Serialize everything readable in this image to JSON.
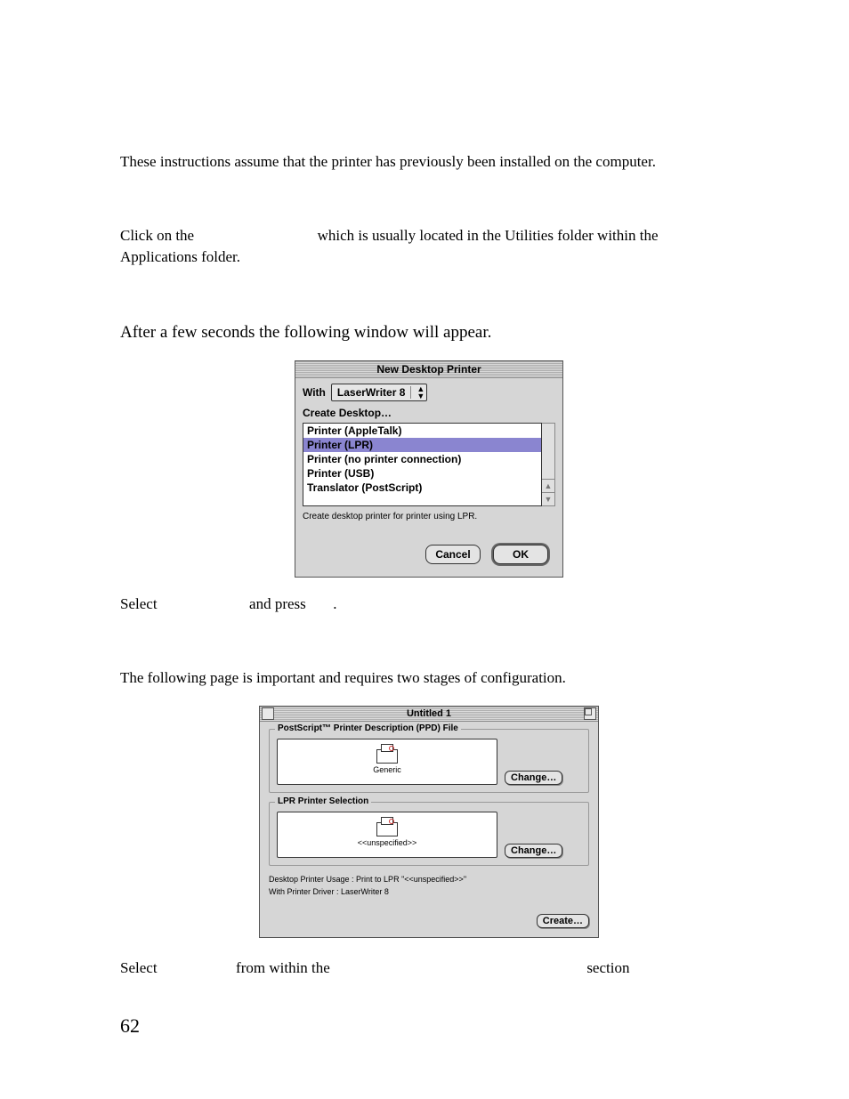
{
  "doc": {
    "intro": "These instructions assume that the printer has previously been installed on the computer.",
    "click_on_the": "Click on the",
    "click_tail": "which is usually located in the Utilities folder within the Applications folder.",
    "after_seconds": "After a few seconds the following window will appear.",
    "select": "Select",
    "and_press": "and press",
    "period": ".",
    "following_page": "The following page is important and requires two stages of configuration.",
    "from_within_the": "from within the",
    "section_word": "section",
    "page_number": "62"
  },
  "dlg_new": {
    "title": "New Desktop Printer",
    "with_label": "With",
    "with_value": "LaserWriter 8",
    "create_label": "Create Desktop…",
    "items": [
      "Printer (AppleTalk)",
      "Printer (LPR)",
      "Printer (no printer connection)",
      "Printer (USB)",
      "Translator (PostScript)"
    ],
    "selected_index": 1,
    "hint": "Create desktop printer for printer using LPR.",
    "cancel": "Cancel",
    "ok": "OK"
  },
  "dlg_untitled": {
    "title": "Untitled 1",
    "ppd": {
      "legend": "PostScript™ Printer Description (PPD) File",
      "icon_label": "Generic",
      "change": "Change…"
    },
    "lpr": {
      "legend": "LPR Printer Selection",
      "icon_label": "<<unspecified>>",
      "change": "Change…"
    },
    "usage": "Desktop Printer Usage : Print to LPR \"<<unspecified>>\"",
    "driver": "With Printer Driver : LaserWriter 8",
    "create": "Create…"
  }
}
